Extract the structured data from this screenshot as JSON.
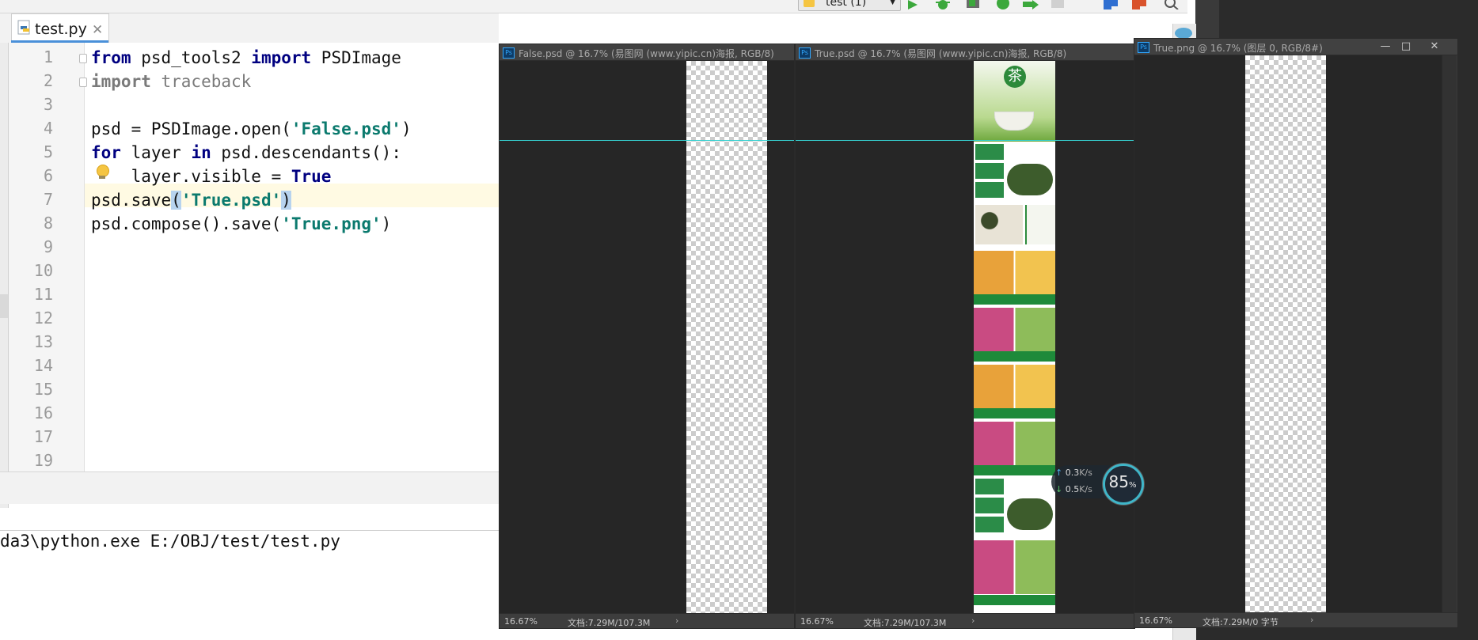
{
  "ide": {
    "run_config": "test (1)",
    "tab_label": "test.py",
    "line_numbers": [
      "1",
      "2",
      "3",
      "4",
      "5",
      "6",
      "7",
      "8",
      "9",
      "10",
      "11",
      "12",
      "13",
      "14",
      "15",
      "16",
      "17",
      "18",
      "19"
    ],
    "code": {
      "l1_kw1": "from",
      "l1_mod": " psd_tools2 ",
      "l1_kw2": "import",
      "l1_name": " PSDImage",
      "l2_kw": "import",
      "l2_name": " traceback",
      "l4_a": "psd = PSDImage.open(",
      "l4_str": "'False.psd'",
      "l4_b": ")",
      "l5_kw1": "for",
      "l5_a": " layer ",
      "l5_kw2": "in",
      "l5_b": " psd.descendants():",
      "l6_a": "    layer.visible = ",
      "l6_kw": "True",
      "l7_a": "psd.save",
      "l7_p1": "(",
      "l7_str": "'True.psd'",
      "l7_p2": ")",
      "l8_a": "psd.compose().save(",
      "l8_str": "'True.png'",
      "l8_b": ")"
    },
    "console_cmd": "da3\\python.exe E:/OBJ/test/test.py"
  },
  "photoshop": {
    "windows": [
      {
        "title": "False.psd @ 16.7% (易图网 (www.yipic.cn)海报, RGB/8)",
        "zoom": "16.67%",
        "doc": "文档:7.29M/107.3M"
      },
      {
        "title": "True.psd @ 16.7% (易图网 (www.yipic.cn)海报, RGB/8)",
        "zoom": "16.67%",
        "doc": "文档:7.29M/107.3M"
      },
      {
        "title": "True.png @ 16.7% (图层 0, RGB/8#)",
        "zoom": "16.67%",
        "doc": "文档:7.29M/0 字节"
      }
    ],
    "poster_badge": "茶"
  },
  "net_widget": {
    "percent": "85",
    "percent_unit": "%",
    "upload": "0.3",
    "download": "0.5",
    "unit": "K/s"
  },
  "colors": {
    "keyword": "#000080",
    "string": "#0b7a6e",
    "guide": "#36d0d0",
    "tea_green": "#1e8a3a"
  }
}
